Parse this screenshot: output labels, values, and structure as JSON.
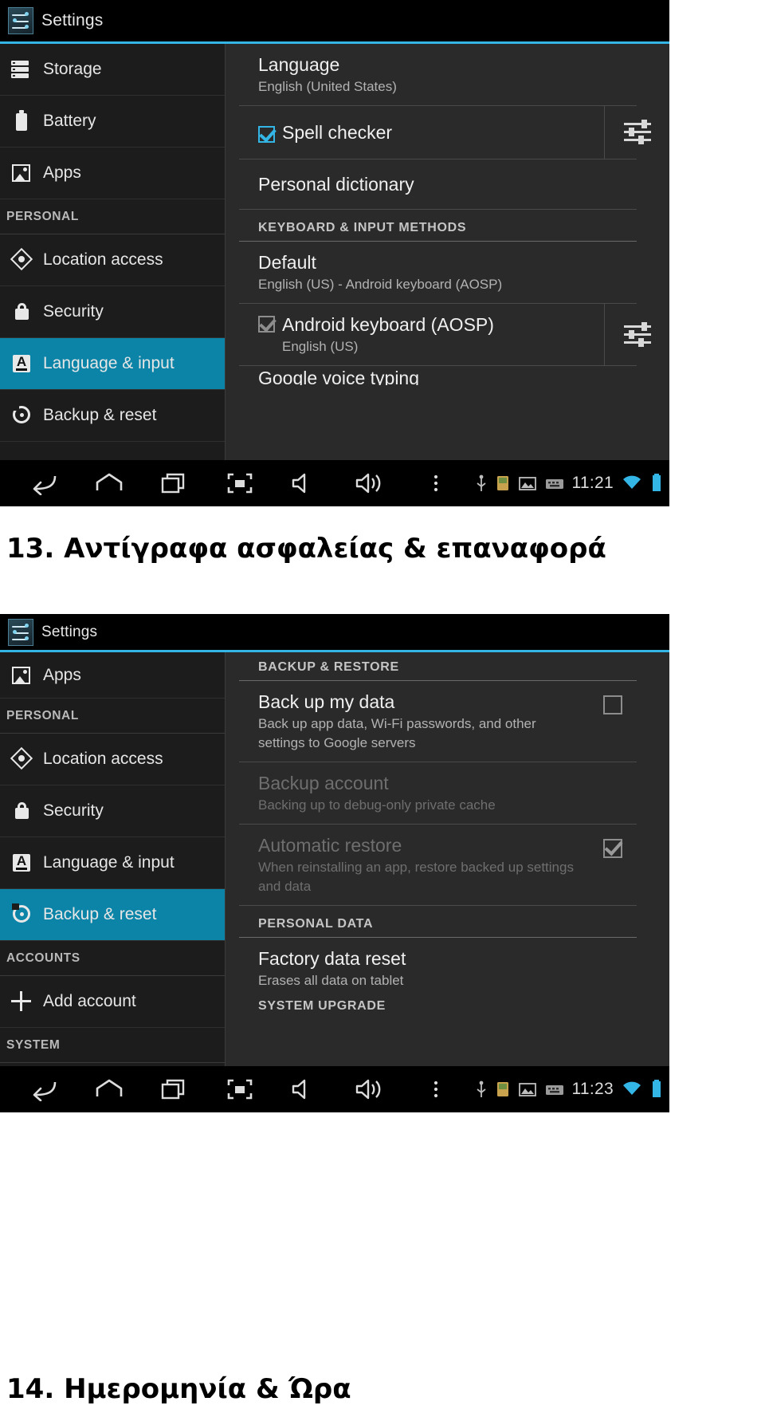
{
  "page": {
    "caption_13": "13. Αντίγραφα ασφαλείας & επαναφορά",
    "caption_14": "14. Ημερομηνία & Ώρα"
  },
  "shot1": {
    "app_title": "Settings",
    "sidebar": [
      {
        "type": "item",
        "label": "Storage",
        "icon": "storage-icon",
        "selected": false
      },
      {
        "type": "item",
        "label": "Battery",
        "icon": "battery-icon",
        "selected": false
      },
      {
        "type": "item",
        "label": "Apps",
        "icon": "apps-icon",
        "selected": false
      },
      {
        "type": "header",
        "label": "PERSONAL"
      },
      {
        "type": "item",
        "label": "Location access",
        "icon": "location-icon",
        "selected": false
      },
      {
        "type": "item",
        "label": "Security",
        "icon": "lock-icon",
        "selected": false
      },
      {
        "type": "item",
        "label": "Language & input",
        "icon": "language-icon",
        "selected": true
      },
      {
        "type": "item",
        "label": "Backup & reset",
        "icon": "backup-restore-icon",
        "selected": false
      }
    ],
    "content": {
      "language_title": "Language",
      "language_sub": "English (United States)",
      "spell_checker": "Spell checker",
      "spell_checker_checked": true,
      "personal_dictionary": "Personal dictionary",
      "section_keyboard": "KEYBOARD & INPUT METHODS",
      "default_title": "Default",
      "default_sub": "English (US) - Android keyboard (AOSP)",
      "aosp_title": "Android keyboard (AOSP)",
      "aosp_sub": "English (US)",
      "aosp_checked": true,
      "clipped_row": "Google voice typing"
    },
    "navbar": {
      "back": "back-icon",
      "home": "home-icon",
      "recents": "recent-apps-icon",
      "screenshot": "screenshot-icon",
      "volume_down": "volume-down-icon",
      "volume_up": "volume-up-icon",
      "overflow": "overflow-menu-icon",
      "usb": "usb-icon",
      "sd": "sd-card-icon",
      "image": "image-icon",
      "keyboard": "keyboard-icon",
      "clock": "11:21",
      "wifi": "wifi-icon",
      "battery": "battery-status-icon"
    }
  },
  "shot2": {
    "app_title": "Settings",
    "sidebar": [
      {
        "type": "item",
        "label": "Apps",
        "icon": "apps-icon",
        "selected": false
      },
      {
        "type": "header",
        "label": "PERSONAL"
      },
      {
        "type": "item",
        "label": "Location access",
        "icon": "location-icon",
        "selected": false
      },
      {
        "type": "item",
        "label": "Security",
        "icon": "lock-icon",
        "selected": false
      },
      {
        "type": "item",
        "label": "Language & input",
        "icon": "language-icon",
        "selected": false
      },
      {
        "type": "item",
        "label": "Backup & reset",
        "icon": "backup-restore-icon",
        "selected": true
      },
      {
        "type": "header",
        "label": "ACCOUNTS"
      },
      {
        "type": "item",
        "label": "Add account",
        "icon": "plus-icon",
        "selected": false
      },
      {
        "type": "header",
        "label": "SYSTEM"
      }
    ],
    "content": {
      "section_backup": "BACKUP & RESTORE",
      "backup_title": "Back up my data",
      "backup_sub": "Back up app data, Wi-Fi passwords, and other settings to Google servers",
      "backup_checked": false,
      "backup_account_title": "Backup account",
      "backup_account_sub": "Backing up to debug-only private cache",
      "auto_restore_title": "Automatic restore",
      "auto_restore_sub": "When reinstalling an app, restore backed up settings and data",
      "auto_restore_checked": true,
      "section_personal_data": "PERSONAL DATA",
      "factory_title": "Factory data reset",
      "factory_sub": "Erases all data on tablet",
      "clipped_section": "SYSTEM UPGRADE"
    },
    "navbar": {
      "clock": "11:23"
    }
  },
  "colors": {
    "accent": "#33b5e5",
    "selected_row": "#0b84a8",
    "content_bg": "#2a2a2a",
    "sidebar_bg": "#1c1c1c"
  }
}
